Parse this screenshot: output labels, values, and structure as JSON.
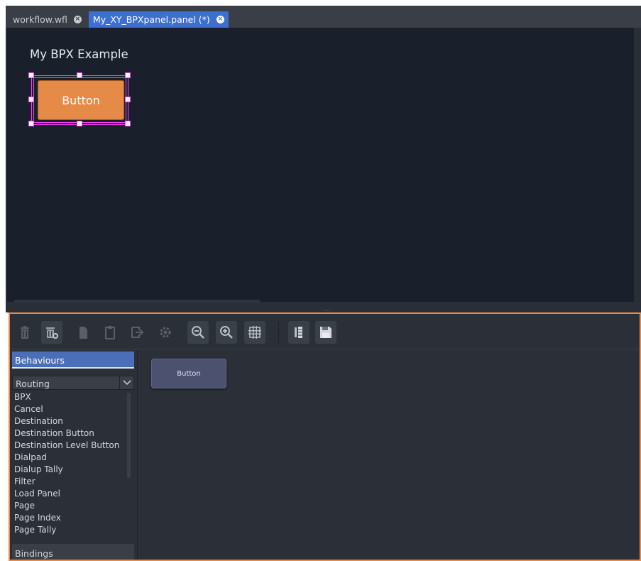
{
  "tabs": [
    {
      "label": "workflow.wfl",
      "active": false,
      "close_icon": "close-circle-icon"
    },
    {
      "label": "My_XY_BPXpanel.panel (*)",
      "active": true,
      "close_icon": "close-circle-icon"
    }
  ],
  "canvas": {
    "title": "My BPX Example",
    "button_label": "Button",
    "button_color": "#e58a47",
    "selection_color": "#ff40ff"
  },
  "toolbar": {
    "buttons": [
      {
        "name": "delete-icon",
        "enabled": false
      },
      {
        "name": "delete-all-icon",
        "enabled": true
      },
      {
        "name": "copy-icon",
        "enabled": false
      },
      {
        "name": "paste-icon",
        "enabled": false
      },
      {
        "name": "export-icon",
        "enabled": false
      },
      {
        "name": "settings-icon",
        "enabled": false
      },
      {
        "name": "zoom-out-icon",
        "enabled": true
      },
      {
        "name": "zoom-in-icon",
        "enabled": true
      },
      {
        "name": "grid-icon",
        "enabled": true
      },
      {
        "name": "align-icon",
        "enabled": true
      },
      {
        "name": "save-icon",
        "enabled": true
      }
    ]
  },
  "sidebar": {
    "behaviours_tab": "Behaviours",
    "category_select": "Routing",
    "items": [
      "BPX",
      "Cancel",
      "Destination",
      "Destination Button",
      "Destination Level Button",
      "Dialpad",
      "Dialup Tally",
      "Filter",
      "Load Panel",
      "Page",
      "Page Index",
      "Page Tally"
    ],
    "bindings_tab": "Bindings"
  },
  "palette": {
    "button_label": "Button"
  },
  "colors": {
    "accent_blue": "#3d6fd1",
    "highlight_orange": "#e88a4a"
  }
}
